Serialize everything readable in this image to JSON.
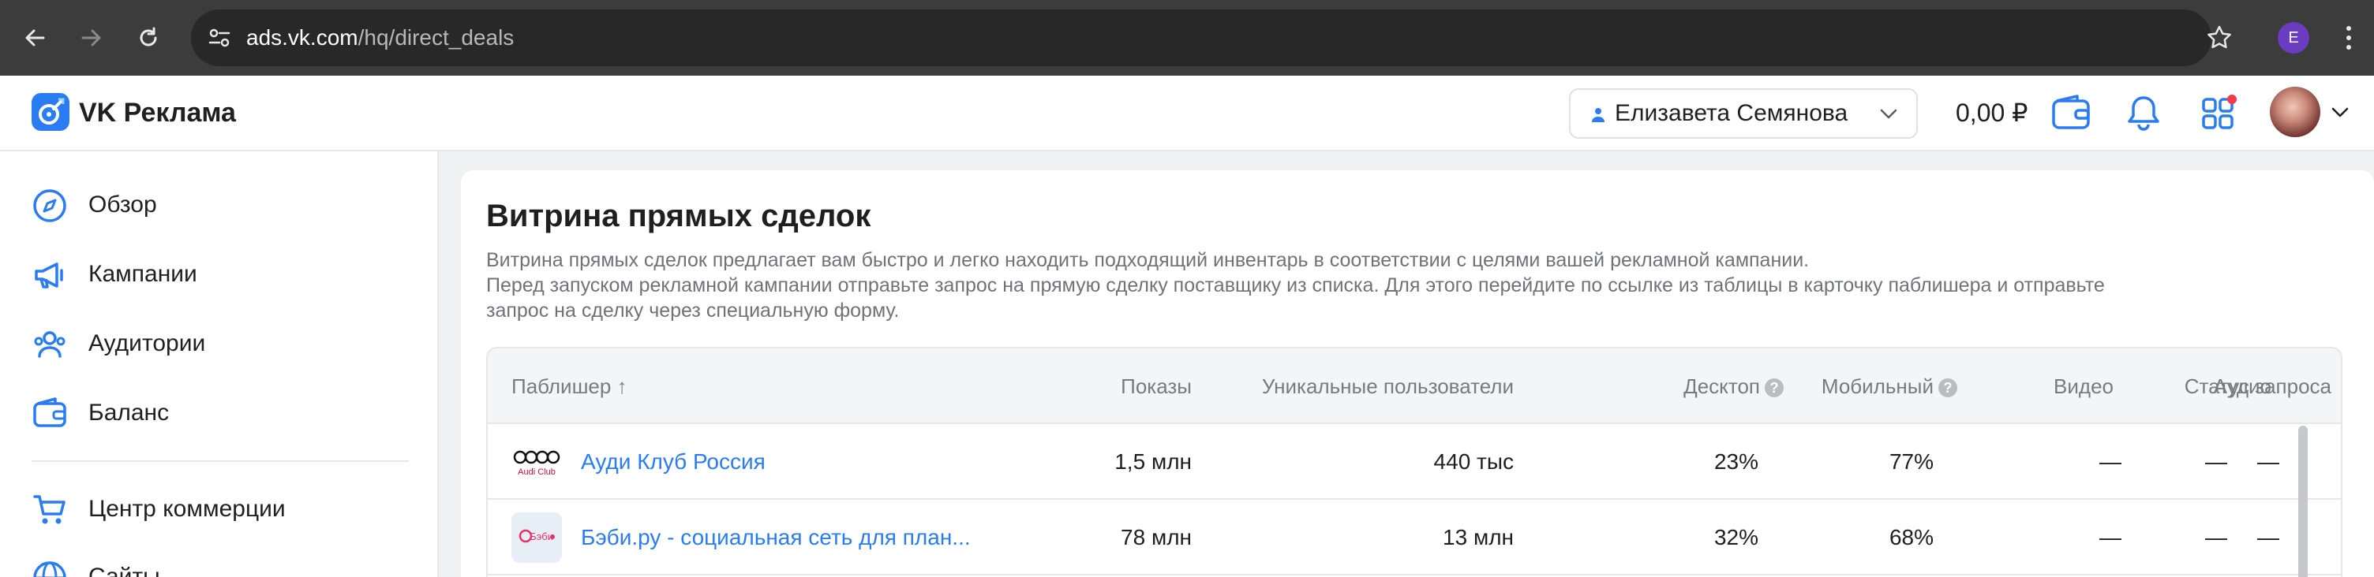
{
  "browser": {
    "url_host": "ads.vk.com",
    "url_path": "/hq/direct_deals",
    "profile_initial": "E",
    "icons": [
      "back-icon",
      "forward-icon",
      "reload-icon",
      "site-settings-icon",
      "bookmark-star-icon",
      "menu-kebab-icon"
    ]
  },
  "header": {
    "logo_text": "VK Реклама",
    "user_name": "Елизавета Семянова",
    "balance": "0,00 ₽",
    "icons": [
      "wallet-icon",
      "bell-icon",
      "apps-icon"
    ]
  },
  "sidebar": {
    "items": [
      {
        "label": "Обзор",
        "icon": "compass-icon"
      },
      {
        "label": "Кампании",
        "icon": "megaphone-icon"
      },
      {
        "label": "Аудитории",
        "icon": "users-icon"
      },
      {
        "label": "Баланс",
        "icon": "wallet-icon"
      },
      {
        "label": "Центр коммерции",
        "icon": "cart-icon"
      },
      {
        "label": "Сайты",
        "icon": "globe-icon"
      }
    ]
  },
  "main": {
    "title": "Витрина прямых сделок",
    "desc_line1": "Витрина прямых сделок предлагает вам быстро и легко находить подходящий инвентарь в соответствии с целями вашей рекламной кампании.",
    "desc_line2": "Перед запуском рекламной кампании отправьте запрос на прямую сделку поставщику из списка. Для этого перейдите по ссылке из таблицы в карточку паблишера и отправьте",
    "desc_line3": "запрос на сделку через специальную форму.",
    "table": {
      "columns": {
        "publisher": "Паблишер ↑",
        "impressions": "Показы",
        "unique_users": "Уникальные пользователи",
        "desktop": "Десктоп",
        "mobile": "Мобильный",
        "video": "Видео",
        "audio": "Аудио",
        "request_status": "Статус запроса"
      },
      "help_glyph": "?",
      "rows": [
        {
          "publisher": "Ауди Клуб Россия",
          "logo_caption": "Audi Club",
          "impressions": "1,5 млн",
          "unique_users": "440 тыс",
          "desktop": "23%",
          "mobile": "77%",
          "video": "—",
          "audio": "—",
          "request_status": "—"
        },
        {
          "publisher": "Бэби.ру - социальная сеть для план...",
          "logo_caption": "Бэби",
          "impressions": "78 млн",
          "unique_users": "13 млн",
          "desktop": "32%",
          "mobile": "68%",
          "video": "—",
          "audio": "—",
          "request_status": "—"
        }
      ]
    }
  },
  "colors": {
    "accent": "#2a7cf2",
    "chrome": "#3c3c3c",
    "page_bg": "#f0f1f3",
    "muted_text": "#6f7378"
  }
}
